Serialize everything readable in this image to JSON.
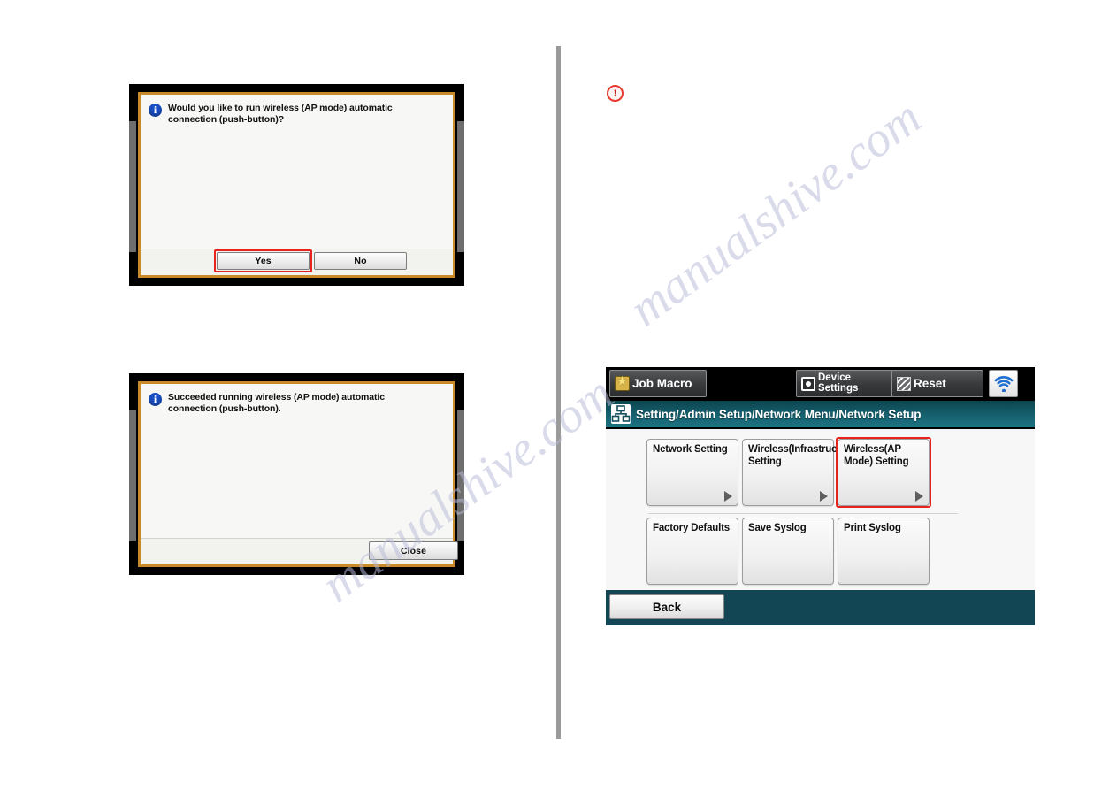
{
  "page": {
    "background_color": "#ffffff",
    "divider_color": "#9a9a9a",
    "watermark_lines": [
      "manualshive.com",
      "manualshive.com"
    ]
  },
  "caution_marker": {
    "icon": "exclamation-circle-icon",
    "glyph": "!",
    "color": "#e8392f"
  },
  "dialogs": [
    {
      "id": "confirm-dialog",
      "icon": "info-icon",
      "message": "Would you like to run wireless (AP mode) automatic connection (push-button)?",
      "buttons": [
        {
          "label": "Yes",
          "selected": true
        },
        {
          "label": "No",
          "selected": false
        }
      ],
      "selection_color": "#e8231d",
      "border_color": "#c98a2a"
    },
    {
      "id": "success-dialog",
      "icon": "info-icon",
      "message": "Succeeded running wireless (AP mode) automatic connection (push-button).",
      "buttons": [
        {
          "label": "Close",
          "selected": false
        }
      ],
      "selection_color": "#e8231d",
      "border_color": "#c98a2a"
    }
  ],
  "panel": {
    "topbar": {
      "job_macro": {
        "label": "Job Macro",
        "icon": "star-icon"
      },
      "device_settings": {
        "label": "Device\nSettings",
        "icon": "device-settings-icon"
      },
      "reset": {
        "label": "Reset",
        "icon": "reset-icon"
      },
      "wifi": {
        "icon": "wifi-icon",
        "color": "#1f6fd0"
      }
    },
    "breadcrumb": {
      "icon": "network-hierarchy-icon",
      "text": "Setting/Admin Setup/Network Menu/Network Setup",
      "background_color": "#16616f"
    },
    "tiles_row1": [
      {
        "label": "Network Setting",
        "selected": false,
        "arrow": true
      },
      {
        "label": "Wireless(Infrastructure) Setting",
        "selected": false,
        "arrow": true
      },
      {
        "label": "Wireless(AP Mode) Setting",
        "selected": true,
        "arrow": true
      }
    ],
    "tiles_row2": [
      {
        "label": "Factory Defaults",
        "selected": false,
        "arrow": false
      },
      {
        "label": "Save Syslog",
        "selected": false,
        "arrow": false
      },
      {
        "label": "Print Syslog",
        "selected": false,
        "arrow": false
      }
    ],
    "footer": {
      "back_label": "Back",
      "background_color": "#134655"
    }
  }
}
